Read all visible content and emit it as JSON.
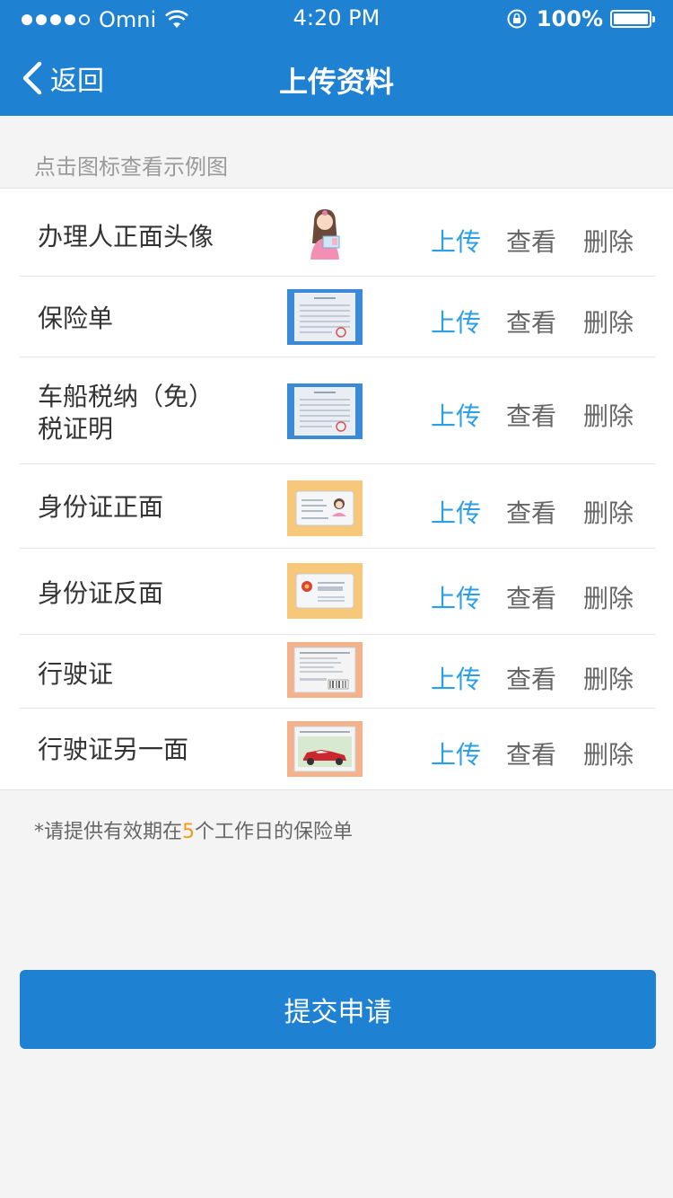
{
  "status_bar": {
    "carrier": "Omni",
    "time": "4:20 PM",
    "battery": "100%"
  },
  "nav": {
    "back_label": "返回",
    "title": "上传资料"
  },
  "hint": "点击图标查看示例图",
  "rows": [
    {
      "label": "办理人正面头像",
      "thumb": "portrait-holding-id-icon"
    },
    {
      "label": "保险单",
      "thumb": "insurance-document-icon"
    },
    {
      "label": "车船税纳（免）税证明",
      "label_line1": "车船税纳（免）",
      "label_line2": "税证明",
      "thumb": "tax-certificate-icon"
    },
    {
      "label": "身份证正面",
      "thumb": "id-card-front-icon"
    },
    {
      "label": "身份证反面",
      "thumb": "id-card-back-icon"
    },
    {
      "label": "行驶证",
      "thumb": "vehicle-license-icon"
    },
    {
      "label": "行驶证另一面",
      "thumb": "vehicle-license-back-icon"
    }
  ],
  "actions": {
    "upload": "上传",
    "view": "查看",
    "delete": "删除"
  },
  "note": {
    "prefix": "*请提供有效期在",
    "highlight": "5",
    "suffix": "个工作日的保险单"
  },
  "submit_label": "提交申请",
  "colors": {
    "brand_blue": "#1e81d2",
    "upload_blue": "#2a9ee6",
    "highlight_orange": "#f39a1e"
  }
}
